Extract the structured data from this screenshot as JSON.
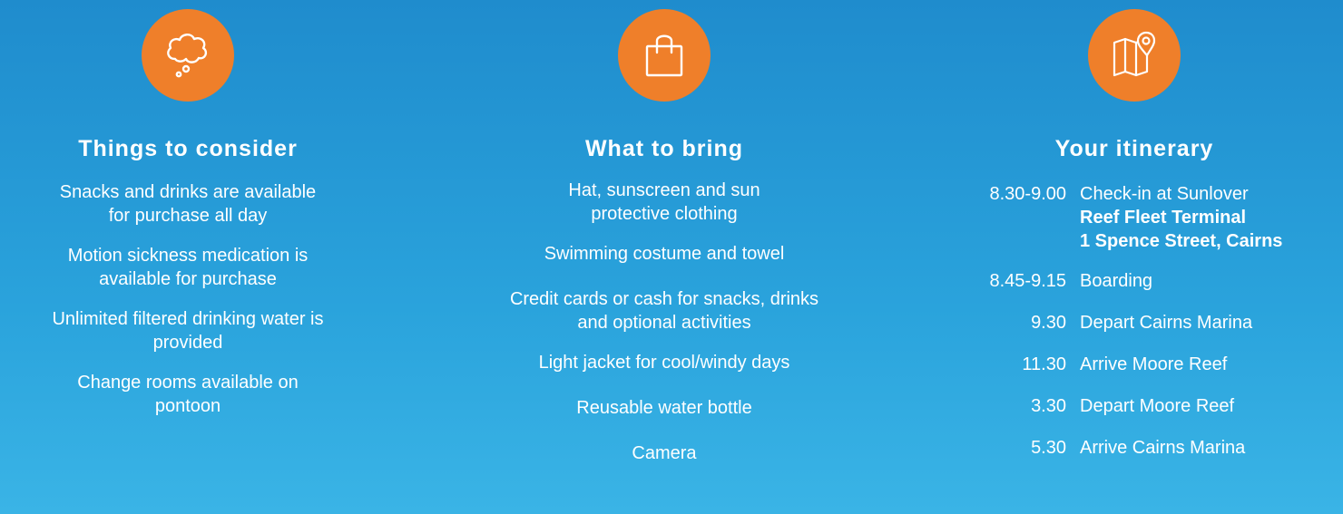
{
  "columns": {
    "consider": {
      "icon": "thought-bubble-icon",
      "title": "Things to consider",
      "items": [
        "Snacks and drinks are available for purchase all day",
        "Motion sickness medication is available for purchase",
        "Unlimited filtered drinking water is provided",
        "Change rooms available on pontoon"
      ]
    },
    "bring": {
      "icon": "shopping-bag-icon",
      "title": "What to bring",
      "items": [
        "Hat, sunscreen and sun protective clothing",
        "Swimming costume and towel",
        "Credit cards or cash for snacks, drinks and optional activities",
        "Light jacket for cool/windy days",
        "Reusable water bottle",
        "Camera"
      ]
    },
    "itinerary": {
      "icon": "map-pin-icon",
      "title": "Your itinerary",
      "rows": [
        {
          "time": "8.30-9.00",
          "desc": "Check-in at Sunlover",
          "bold1": "Reef Fleet Terminal",
          "bold2": "1 Spence Street, Cairns"
        },
        {
          "time": "8.45-9.15",
          "desc": "Boarding"
        },
        {
          "time": "9.30",
          "desc": "Depart Cairns Marina"
        },
        {
          "time": "11.30",
          "desc": "Arrive Moore Reef"
        },
        {
          "time": "3.30",
          "desc": "Depart Moore Reef"
        },
        {
          "time": "5.30",
          "desc": "Arrive Cairns Marina"
        }
      ]
    }
  },
  "colors": {
    "background": "#1f8ccd",
    "badge": "#ef7f2a",
    "text": "#ffffff"
  }
}
